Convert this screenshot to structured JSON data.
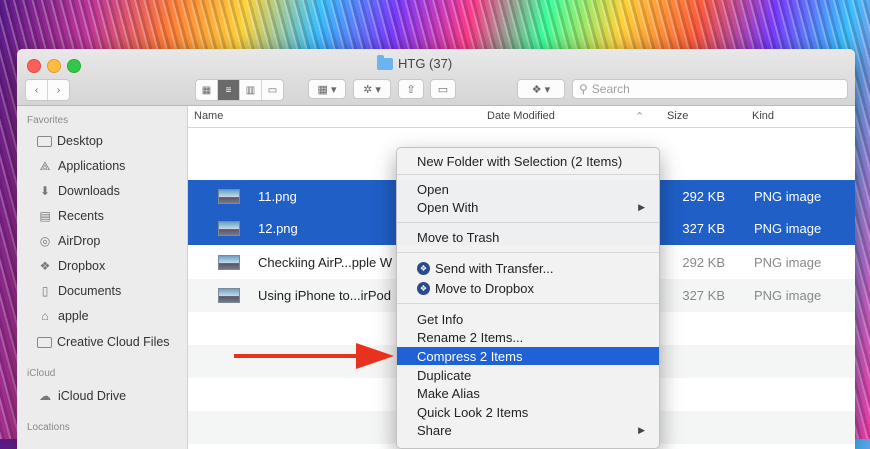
{
  "window": {
    "title": "HTG (37)"
  },
  "toolbar": {
    "back_label": "‹",
    "forward_label": "›",
    "search_placeholder": "Search"
  },
  "sidebar": {
    "sections": [
      {
        "label": "Favorites"
      },
      {
        "label": "iCloud"
      },
      {
        "label": "Locations"
      }
    ],
    "items": [
      {
        "label": "Desktop",
        "icon": "desktop-icon"
      },
      {
        "label": "Applications",
        "icon": "applications-icon"
      },
      {
        "label": "Downloads",
        "icon": "downloads-icon"
      },
      {
        "label": "Recents",
        "icon": "recents-icon"
      },
      {
        "label": "AirDrop",
        "icon": "airdrop-icon"
      },
      {
        "label": "Dropbox",
        "icon": "dropbox-icon"
      },
      {
        "label": "Documents",
        "icon": "documents-icon"
      },
      {
        "label": "apple",
        "icon": "home-icon"
      },
      {
        "label": "Creative Cloud Files",
        "icon": "folder-icon"
      },
      {
        "label": "iCloud Drive",
        "icon": "cloud-icon"
      }
    ]
  },
  "columns": {
    "name": "Name",
    "date": "Date Modified",
    "size": "Size",
    "kind": "Kind"
  },
  "files": [
    {
      "name": "11.png",
      "size": "292 KB",
      "kind": "PNG image",
      "selected": true
    },
    {
      "name": "12.png",
      "size": "327 KB",
      "kind": "PNG image",
      "selected": true
    },
    {
      "name": "Checkiing AirP...pple W",
      "size": "292 KB",
      "kind": "PNG image",
      "selected": false
    },
    {
      "name": "Using iPhone to...irPod",
      "size": "327 KB",
      "kind": "PNG image",
      "selected": false
    }
  ],
  "context_menu": {
    "items": [
      {
        "label": "New Folder with Selection (2 Items)"
      },
      {
        "label": "Open"
      },
      {
        "label": "Open With",
        "submenu": true
      },
      {
        "label": "Move to Trash"
      },
      {
        "label": "Send with Transfer...",
        "icon": "dropbox-transfer-icon"
      },
      {
        "label": "Move to Dropbox",
        "icon": "dropbox-icon"
      },
      {
        "label": "Get Info"
      },
      {
        "label": "Rename 2 Items..."
      },
      {
        "label": "Compress 2 Items",
        "highlighted": true
      },
      {
        "label": "Duplicate"
      },
      {
        "label": "Make Alias"
      },
      {
        "label": "Quick Look 2 Items"
      },
      {
        "label": "Share",
        "submenu": true
      }
    ]
  },
  "colors": {
    "selection": "#1f5fc6",
    "menu_highlight": "#1f62d6",
    "annotation_arrow": "#e8321e"
  }
}
